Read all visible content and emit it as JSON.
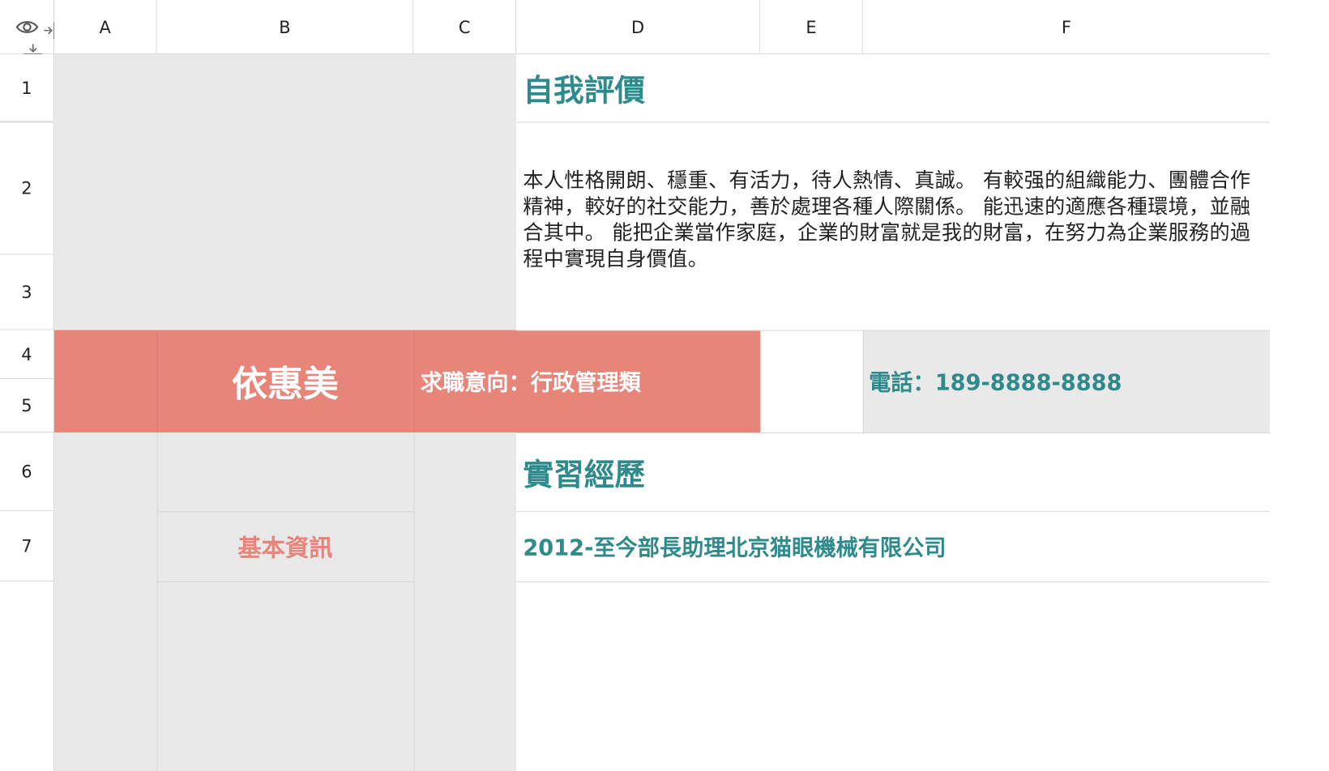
{
  "columns": [
    "A",
    "B",
    "C",
    "D",
    "E",
    "F"
  ],
  "rows": [
    "1",
    "2",
    "3",
    "4",
    "5",
    "6",
    "7"
  ],
  "icons": {
    "toggle_visibility": "eye-icon",
    "column_resize": "column-resize-icon",
    "row_resize": "row-resize-icon"
  },
  "colors": {
    "accent_teal": "#2f8a8c",
    "accent_coral": "#e8857a",
    "panel_gray": "#e9e9e9"
  },
  "cells": {
    "self_eval_title": "自我評價",
    "self_eval_text": "本人性格開朗、穩重、有活力，待人熱情、真誠。 有較强的組織能力、團體合作精神，較好的社交能力，善於處理各種人際關係。 能迅速的適應各種環境，並融合其中。 能把企業當作家庭，企業的財富就是我的財富，在努力為企業服務的過程中實現自身價值。",
    "name": "依惠美",
    "job_intent": "求職意向：行政管理類",
    "phone": "電話：189-8888-8888",
    "internship_title": "實習經歷",
    "basic_info": "基本資訊",
    "internship_item": "2012-至今部長助理北京猫眼機械有限公司"
  }
}
